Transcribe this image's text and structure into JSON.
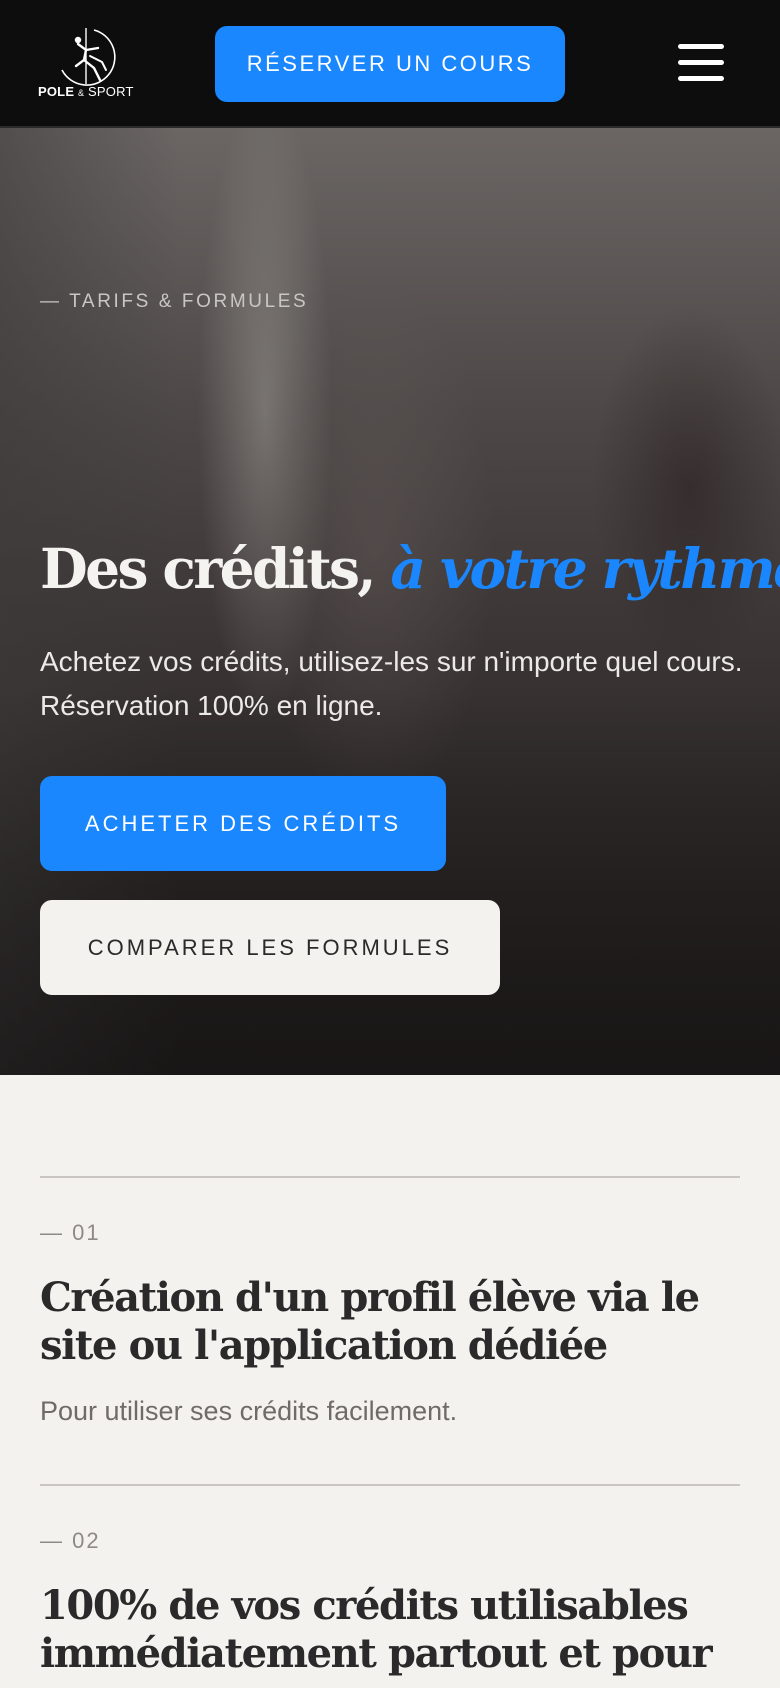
{
  "header": {
    "logo_main": "POLE",
    "logo_amp": "&",
    "logo_sport": "SPORT",
    "book_button": "RÉSERVER UN COURS",
    "menu_icon": "hamburger-menu-icon"
  },
  "hero": {
    "eyebrow": "— TARIFS & FORMULES",
    "title_plain": "Des crédits,",
    "title_accent": "à votre rythme.",
    "subtitle": "Achetez vos crédits, utilisez-les sur n'importe quel cours. Réservation 100% en ligne.",
    "primary_button": "ACHETER DES CRÉDITS",
    "secondary_button": "COMPARER LES FORMULES"
  },
  "steps": [
    {
      "number": "— 01",
      "title": "Création d'un profil élève via le site ou l'application dédiée",
      "description": "Pour utiliser ses crédits facilement."
    },
    {
      "number": "— 02",
      "title": "100% de vos crédits utilisables immédiatement partout et pour",
      "description": ""
    }
  ],
  "colors": {
    "accent": "#1a87ff",
    "header_bg": "#0d0d0d",
    "page_bg": "#f4f2ef"
  }
}
